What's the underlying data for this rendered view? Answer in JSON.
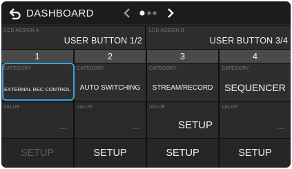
{
  "header": {
    "title": "DASHBOARD",
    "back_icon": "back-return-icon",
    "prev_icon": "chevron-left-icon",
    "next_icon": "chevron-right-icon",
    "page_indicator": {
      "pages": 3,
      "current": 1
    }
  },
  "lcd": [
    {
      "label": "LCD ASSIGN A",
      "value": "USER BUTTON 1/2"
    },
    {
      "label": "LCD ASSIGN B",
      "value": "USER BUTTON 3/4"
    }
  ],
  "channels": [
    {
      "number": "1",
      "category_label": "CATEGORY",
      "category": "EXTERNAL REC CONTROL",
      "value_label": "VALUE",
      "value": "---",
      "setup": "SETUP",
      "setup_enabled": false,
      "selected": true
    },
    {
      "number": "2",
      "category_label": "CATEGORY",
      "category": "AUTO SWITCHING",
      "value_label": "VALUE",
      "value": "---",
      "setup": "SETUP",
      "setup_enabled": true,
      "selected": false
    },
    {
      "number": "3",
      "category_label": "CATEGORY",
      "category": "STREAM/RECORD",
      "value_label": "VALUE",
      "value": "SETUP",
      "setup": "SETUP",
      "setup_enabled": true,
      "selected": false
    },
    {
      "number": "4",
      "category_label": "CATEGORY",
      "category": "SEQUENCER",
      "value_label": "VALUE",
      "value": "---",
      "setup": "SETUP",
      "setup_enabled": true,
      "selected": false
    }
  ],
  "colors": {
    "background": "#0f0f0f",
    "selection": "#3aa0e0",
    "text": "#f2f2f2",
    "muted": "#7a7a7a"
  }
}
